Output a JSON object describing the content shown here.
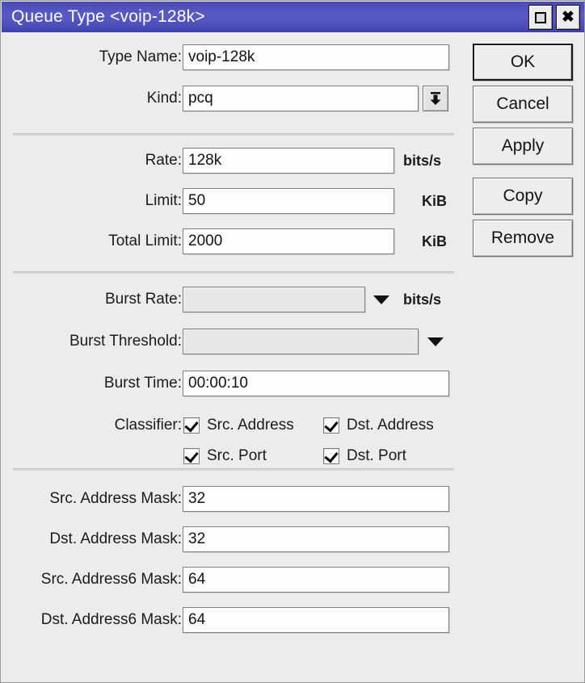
{
  "window": {
    "title": "Queue Type <voip-128k>",
    "titlebar_gradient_top": "#4a4ab4",
    "titlebar_gradient_bottom": "#3f3fa8",
    "background": "#ececec",
    "controls": [
      {
        "name": "maximize",
        "icon": "maximize-icon"
      },
      {
        "name": "close",
        "icon": "close-icon",
        "glyph": "✖"
      }
    ]
  },
  "form": {
    "type_name": {
      "label": "Type Name:",
      "value": "voip-128k"
    },
    "kind": {
      "label": "Kind:",
      "value": "pcq",
      "icon": "dropdown-arrow-icon"
    },
    "rate": {
      "label": "Rate:",
      "value": "128k",
      "unit": "bits/s"
    },
    "limit": {
      "label": "Limit:",
      "value": "50",
      "unit": "KiB"
    },
    "total_limit": {
      "label": "Total Limit:",
      "value": "2000",
      "unit": "KiB"
    },
    "burst_rate": {
      "label": "Burst Rate:",
      "value": "",
      "unit": "bits/s",
      "icon": "chevron-down-icon"
    },
    "burst_threshold": {
      "label": "Burst Threshold:",
      "value": "",
      "icon": "chevron-down-icon"
    },
    "burst_time": {
      "label": "Burst Time:",
      "value": "00:00:10"
    },
    "classifier": {
      "label": "Classifier:",
      "options": [
        {
          "label": "Src. Address",
          "checked": true
        },
        {
          "label": "Dst. Address",
          "checked": true
        },
        {
          "label": "Src. Port",
          "checked": true
        },
        {
          "label": "Dst. Port",
          "checked": true
        }
      ]
    },
    "src_address_mask": {
      "label": "Src. Address Mask:",
      "value": "32"
    },
    "dst_address_mask": {
      "label": "Dst. Address Mask:",
      "value": "32"
    },
    "src_address6_mask": {
      "label": "Src. Address6 Mask:",
      "value": "64"
    },
    "dst_address6_mask": {
      "label": "Dst. Address6 Mask:",
      "value": "64"
    }
  },
  "buttons": {
    "ok": "OK",
    "cancel": "Cancel",
    "apply": "Apply",
    "copy": "Copy",
    "remove": "Remove"
  }
}
